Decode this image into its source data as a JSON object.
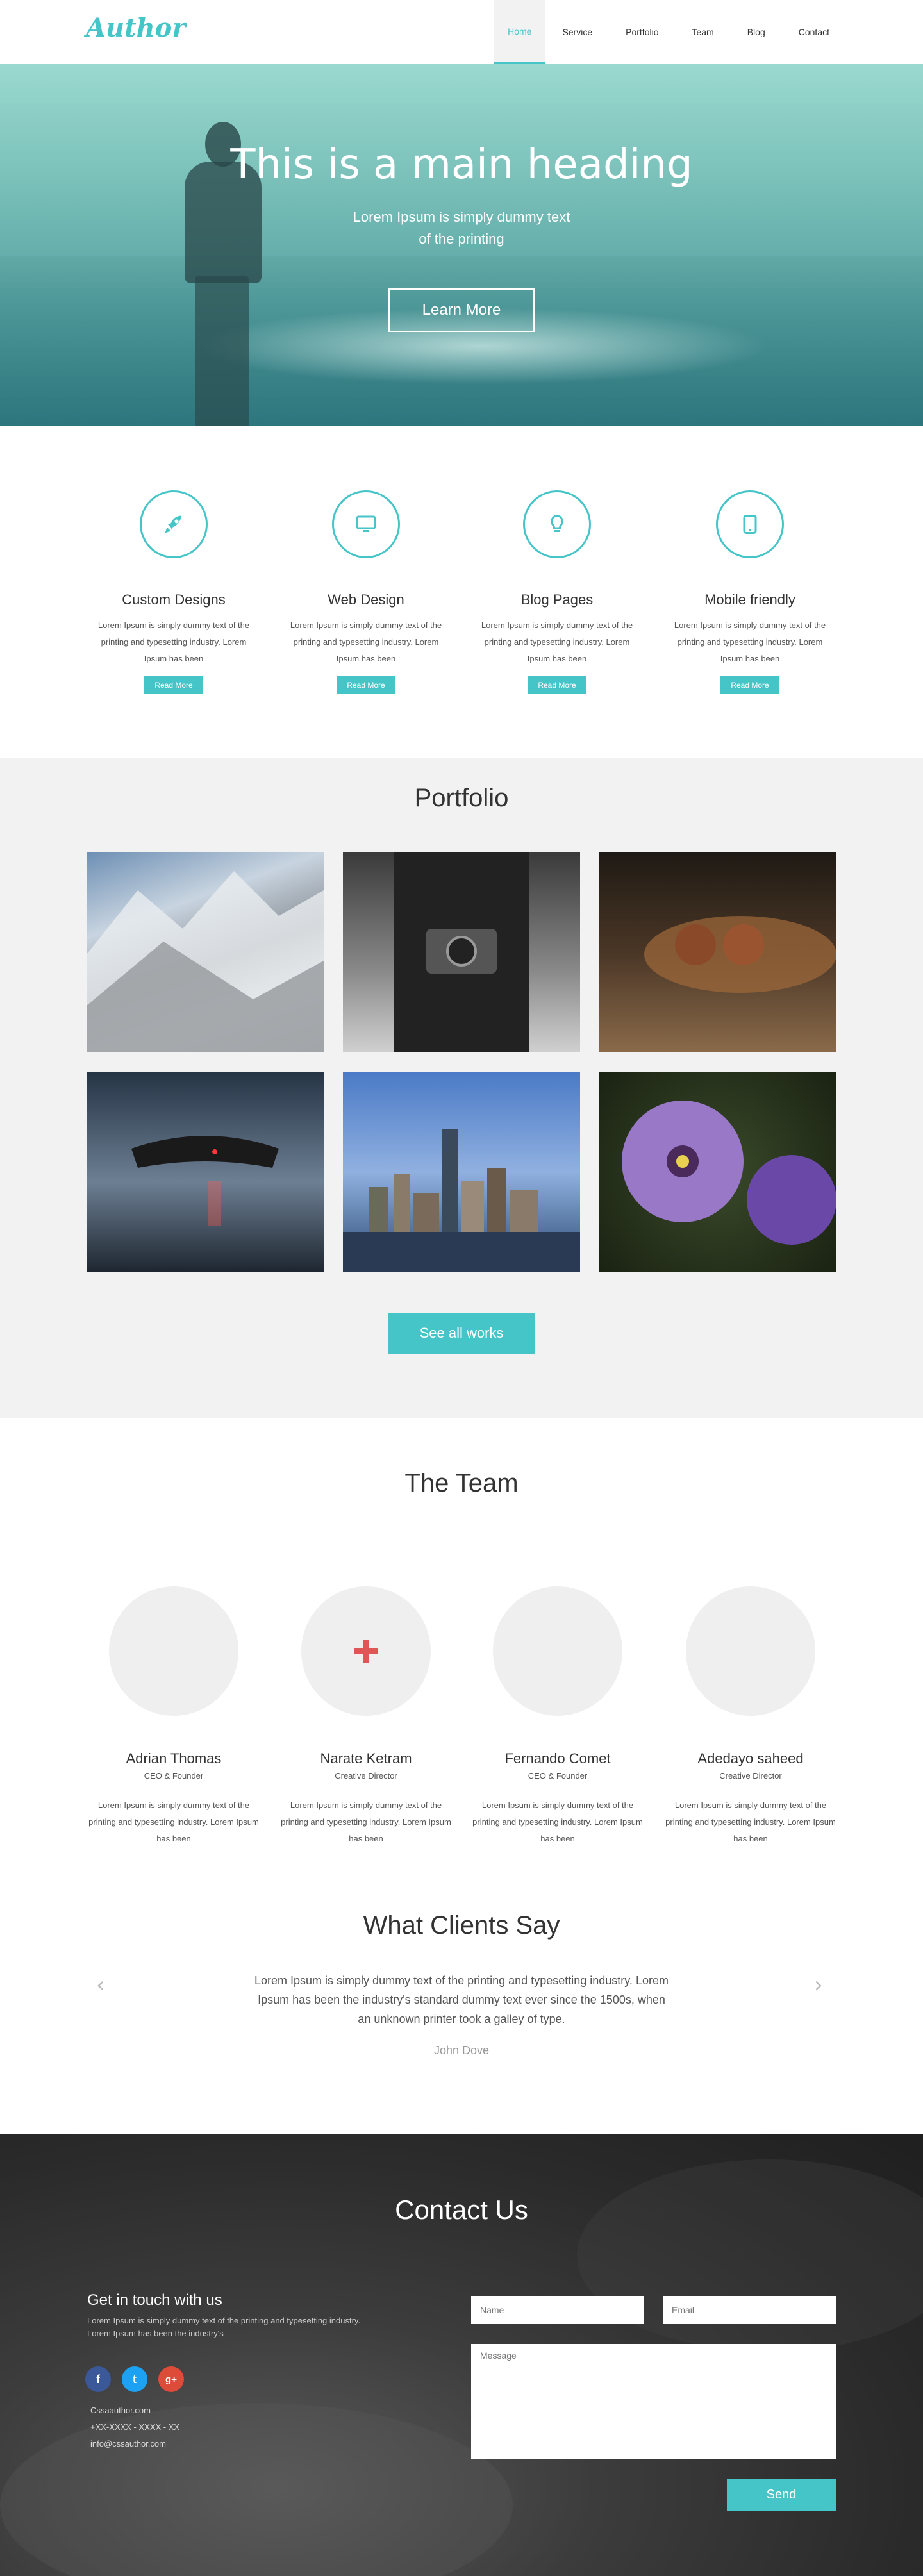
{
  "brand": {
    "logo": "Author",
    "accent_color": "#46c5c8"
  },
  "nav": {
    "items": [
      {
        "label": "Home",
        "active": true
      },
      {
        "label": "Service"
      },
      {
        "label": "Portfolio"
      },
      {
        "label": "Team"
      },
      {
        "label": "Blog"
      },
      {
        "label": "Contact"
      }
    ]
  },
  "hero": {
    "heading": "This is a main heading",
    "subtext_line1": "Lorem Ipsum is simply dummy text",
    "subtext_line2": "of the printing",
    "button": "Learn More"
  },
  "services": [
    {
      "icon": "rocket-icon",
      "title": "Custom Designs",
      "text": "Lorem Ipsum is simply dummy text of the printing and typesetting industry. Lorem Ipsum has been",
      "button": "Read More"
    },
    {
      "icon": "monitor-icon",
      "title": "Web Design",
      "text": "Lorem Ipsum is simply dummy text of the printing and typesetting industry. Lorem Ipsum has been",
      "button": "Read More"
    },
    {
      "icon": "lightbulb-icon",
      "title": "Blog Pages",
      "text": "Lorem Ipsum is simply dummy text of the printing and typesetting industry. Lorem Ipsum has been",
      "button": "Read More"
    },
    {
      "icon": "tablet-icon",
      "title": "Mobile friendly",
      "text": "Lorem Ipsum is simply dummy text of the printing and typesetting industry. Lorem Ipsum has been",
      "button": "Read More"
    }
  ],
  "portfolio": {
    "title": "Portfolio",
    "items": [
      "snowy-mountains",
      "camera-photographer",
      "chestnuts-on-leaf",
      "game-controller",
      "city-skyline",
      "purple-petunia"
    ],
    "button": "See all works"
  },
  "team": {
    "title": "The Team",
    "members": [
      {
        "name": "Adrian Thomas",
        "role": "CEO & Founder",
        "text": "Lorem Ipsum is simply dummy text of the printing and typesetting industry. Lorem Ipsum has been",
        "avatar_icon": ""
      },
      {
        "name": "Narate Ketram",
        "role": "Creative Director",
        "text": "Lorem Ipsum is simply dummy text of the printing and typesetting industry. Lorem Ipsum has been",
        "avatar_icon": "plus-icon"
      },
      {
        "name": "Fernando Comet",
        "role": "CEO & Founder",
        "text": "Lorem Ipsum is simply dummy text of the printing and typesetting industry. Lorem Ipsum has been",
        "avatar_icon": ""
      },
      {
        "name": "Adedayo saheed",
        "role": "Creative Director",
        "text": "Lorem Ipsum is simply dummy text of the printing and typesetting industry. Lorem Ipsum has been",
        "avatar_icon": ""
      }
    ]
  },
  "testimonials": {
    "title": "What Clients Say",
    "quote": "Lorem Ipsum is simply dummy text of the printing and typesetting industry. Lorem Ipsum has been the industry's standard dummy text ever since the 1500s, when an unknown printer took a galley of type.",
    "author": "John Dove",
    "prev_icon": "chevron-left-icon",
    "next_icon": "chevron-right-icon"
  },
  "contact": {
    "title": "Contact Us",
    "get_in_touch": "Get in touch with us",
    "intro": "Lorem Ipsum is simply dummy text of the printing and typesetting industry. Lorem Ipsum has been the industry's",
    "social": [
      {
        "icon": "facebook-icon",
        "glyph": "f",
        "color": "#3b5998"
      },
      {
        "icon": "twitter-icon",
        "glyph": "t",
        "color": "#1da1f2"
      },
      {
        "icon": "google-plus-icon",
        "glyph": "g+",
        "color": "#dd4b39"
      }
    ],
    "website": "Cssaauthor.com",
    "phone": "+XX-XXXX - XXXX - XX",
    "email": "info@cssauthor.com",
    "form": {
      "name_placeholder": "Name",
      "email_placeholder": "Email",
      "message_placeholder": "Message",
      "send_label": "Send"
    }
  }
}
